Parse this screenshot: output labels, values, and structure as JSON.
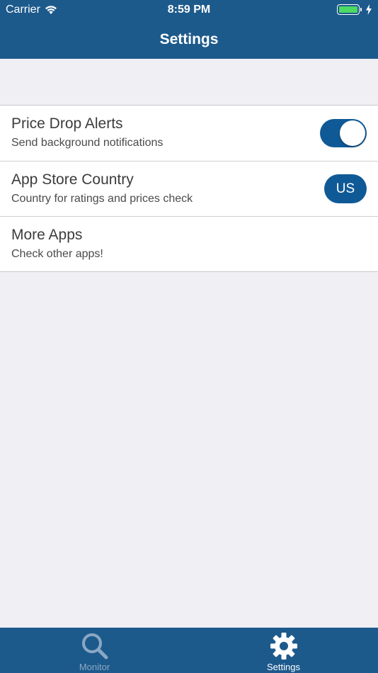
{
  "status_bar": {
    "carrier": "Carrier",
    "time": "8:59 PM",
    "icons": [
      "wifi-icon",
      "battery-icon",
      "charging-bolt-icon"
    ],
    "battery_color": "#4cd964"
  },
  "nav": {
    "title": "Settings"
  },
  "settings": {
    "rows": [
      {
        "title": "Price Drop Alerts",
        "subtitle": "Send background notifications",
        "control": "toggle",
        "toggle_on": true
      },
      {
        "title": "App Store Country",
        "subtitle": "Country for ratings and prices check",
        "control": "button",
        "button_label": "US"
      },
      {
        "title": "More Apps",
        "subtitle": "Check other apps!",
        "control": "none"
      }
    ]
  },
  "tab_bar": {
    "tabs": [
      {
        "label": "Monitor",
        "icon": "search-icon",
        "selected": false
      },
      {
        "label": "Settings",
        "icon": "gear-icon",
        "selected": true
      }
    ]
  },
  "colors": {
    "bar_background": "#1d5a8c",
    "accent": "#0f5a96",
    "page_background": "#efeff4",
    "tab_inactive": "#8aa8c4"
  }
}
